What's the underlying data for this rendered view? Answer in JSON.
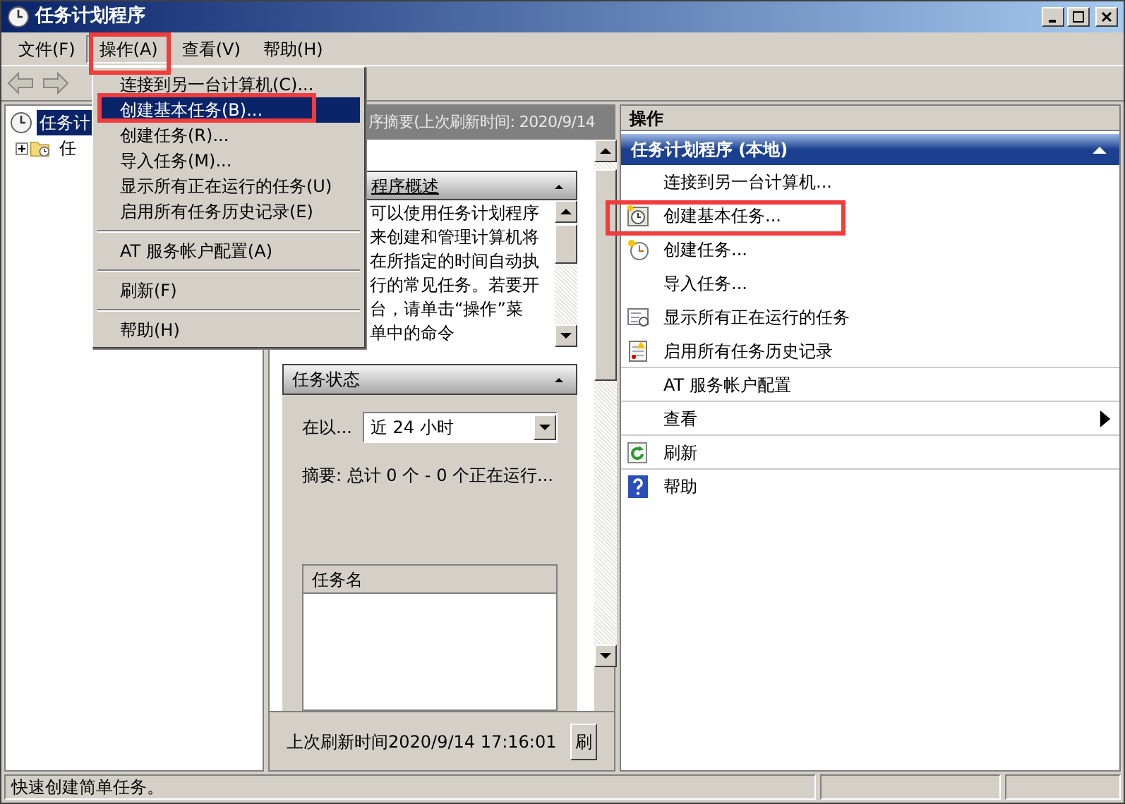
{
  "window": {
    "title": "任务计划程序"
  },
  "menu_bar": [
    {
      "label": "文件(F)",
      "selected": false
    },
    {
      "label": "操作(A)",
      "selected": true
    },
    {
      "label": "查看(V)",
      "selected": false
    },
    {
      "label": "帮助(H)",
      "selected": false
    }
  ],
  "dropdown_menu": [
    {
      "kind": "item",
      "label": "连接到另一台计算机(C)...",
      "selected": false
    },
    {
      "kind": "item",
      "label": "创建基本任务(B)...",
      "selected": true
    },
    {
      "kind": "item",
      "label": "创建任务(R)...",
      "selected": false
    },
    {
      "kind": "item",
      "label": "导入任务(M)...",
      "selected": false
    },
    {
      "kind": "item",
      "label": "显示所有正在运行的任务(U)",
      "selected": false
    },
    {
      "kind": "item",
      "label": "启用所有任务历史记录(E)",
      "selected": false
    },
    {
      "kind": "separator"
    },
    {
      "kind": "item",
      "label": "AT 服务帐户配置(A)",
      "selected": false
    },
    {
      "kind": "separator"
    },
    {
      "kind": "item",
      "label": "刷新(F)",
      "selected": false
    },
    {
      "kind": "separator"
    },
    {
      "kind": "item",
      "label": "帮助(H)",
      "selected": false
    }
  ],
  "tree": [
    {
      "label": "任务计",
      "selected": true,
      "children": [
        {
          "label": "任",
          "selected": false,
          "expanded": false
        }
      ]
    }
  ],
  "summary_pane": {
    "header": "序摘要(上次刷新时间: 2020/9/14",
    "overview": {
      "title": "程序概述",
      "lines": [
        "可以使用任务计划程序",
        "来创建和管理计算机将",
        "在所指定的时间自动执",
        "行的常见任务。若要开",
        "台，请单击“操作”菜",
        "单中的命令"
      ]
    },
    "status": {
      "title": "任务状态",
      "period_label": "在以...",
      "period_value": "近 24 小时",
      "summary": "摘要: 总计 0 个 - 0 个正在运行...",
      "list_column": "任务名"
    },
    "last_refresh": "上次刷新时间2020/9/14 17:16:01",
    "refresh_button": "刷"
  },
  "actions_pane": {
    "header": "操作",
    "group_title": "任务计划程序 (本地)",
    "expanded": true,
    "items": [
      {
        "kind": "item",
        "label": "连接到另一台计算机..."
      },
      {
        "kind": "item",
        "label": "创建基本任务..."
      },
      {
        "kind": "item",
        "label": "创建任务..."
      },
      {
        "kind": "item",
        "label": "导入任务..."
      },
      {
        "kind": "item",
        "label": "显示所有正在运行的任务"
      },
      {
        "kind": "item",
        "label": "启用所有任务历史记录"
      },
      {
        "kind": "item",
        "label": "AT 服务帐户配置"
      },
      {
        "kind": "submenu",
        "label": "查看"
      },
      {
        "kind": "item",
        "label": "刷新"
      },
      {
        "kind": "item",
        "label": "帮助"
      }
    ]
  },
  "status_bar": {
    "text": "快速创建简单任务。"
  }
}
